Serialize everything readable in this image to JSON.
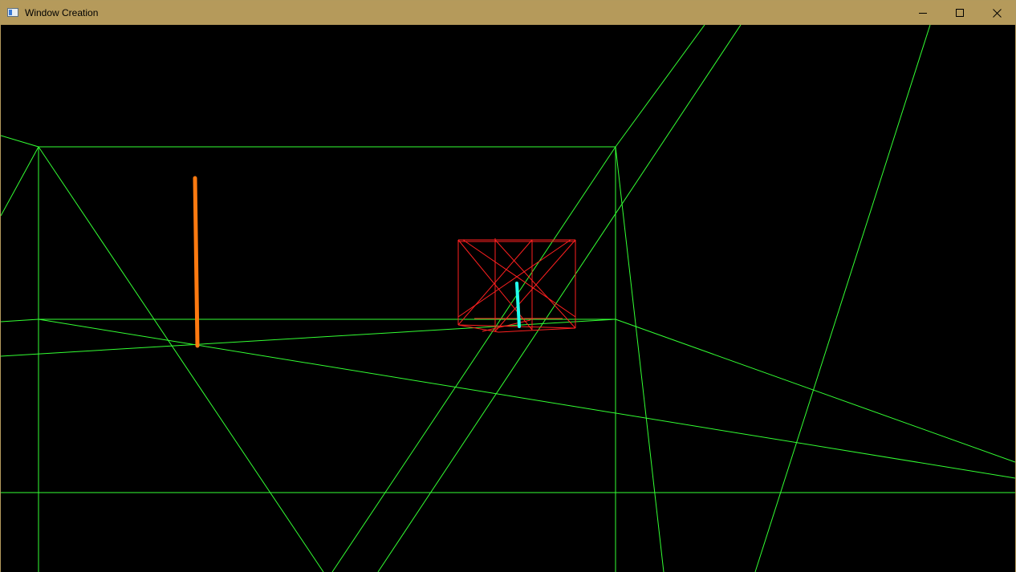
{
  "window": {
    "title": "Window Creation",
    "app_icon": "window-app-icon",
    "controls": [
      {
        "name": "minimize",
        "icon": "minimize-icon"
      },
      {
        "name": "maximize",
        "icon": "maximize-icon"
      },
      {
        "name": "close",
        "icon": "close-icon"
      }
    ],
    "frame_color": "#b59a5b"
  },
  "scene": {
    "background_color": "#000000",
    "wireframe_color": "#33ff33",
    "objects": [
      {
        "name": "green-wireframe-room",
        "color": "#33ff33"
      },
      {
        "name": "red-wireframe-box",
        "color": "#ff2020"
      },
      {
        "name": "orange-line",
        "color": "#ff7a10"
      },
      {
        "name": "cyan-line",
        "color": "#22ffee"
      }
    ]
  }
}
